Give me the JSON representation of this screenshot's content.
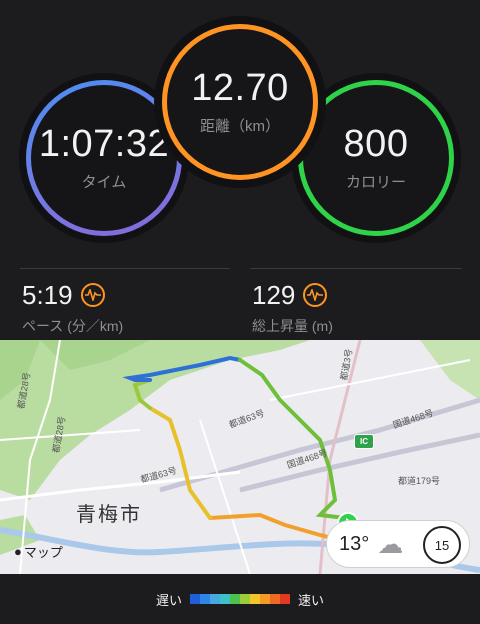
{
  "stats": {
    "time": {
      "value": "1:07:32",
      "label": "タイム"
    },
    "distance": {
      "value": "12.70",
      "label": "距離（km）"
    },
    "calories": {
      "value": "800",
      "label": "カロリー"
    },
    "pace": {
      "value": "5:19",
      "label": "ペース (分／km)",
      "icon": "pulse-icon"
    },
    "elevation": {
      "value": "129",
      "label": "総上昇量 (m)",
      "icon": "pulse-icon"
    }
  },
  "map": {
    "city": "青梅市",
    "attribution": "マップ",
    "labels": {
      "route63_a": "都道63号",
      "route63_b": "都道63号",
      "route28": "都道28号",
      "route468_a": "国道468号",
      "route468_b": "国道468号",
      "route179": "都道179号",
      "route3": "都道3号"
    },
    "ic_label": "IC",
    "weather": {
      "temperature": "13°",
      "icon": "cloud-icon",
      "aqi": "15"
    }
  },
  "legend": {
    "slow_label": "遅い",
    "fast_label": "速い",
    "colors": [
      "#1f5fd8",
      "#2e86e8",
      "#47a8e0",
      "#3cc1c6",
      "#4ec24a",
      "#9ccc3c",
      "#f2c52a",
      "#f59a28",
      "#ee6a22",
      "#e13a1e"
    ]
  },
  "colors": {
    "time_ring": "#4a8ff2",
    "distance_ring": "#ff9423",
    "calorie_ring": "#2fd34a"
  }
}
